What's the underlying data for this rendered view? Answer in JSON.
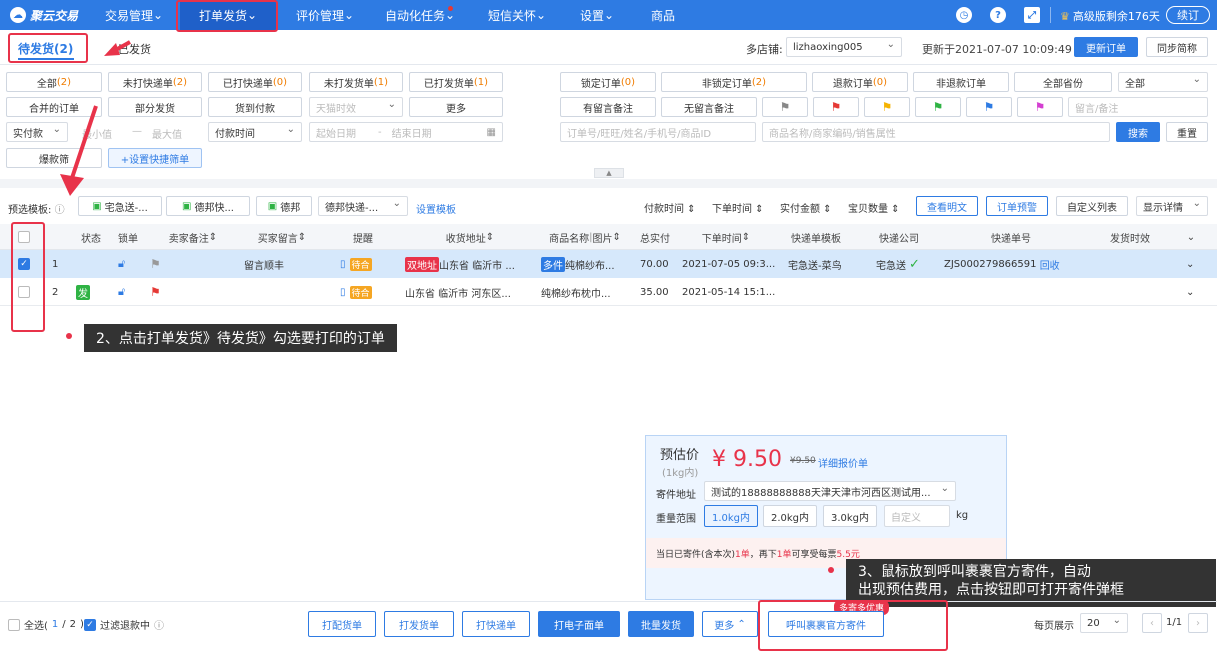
{
  "topbar": {
    "logo": "聚云交易",
    "nav": [
      "交易管理",
      "打单发货",
      "评价管理",
      "自动化任务",
      "短信关怀",
      "设置",
      "商品"
    ],
    "version": "高级版剩余176天",
    "renew": "续订"
  },
  "tabs": {
    "pending": "待发货(2)",
    "shipped": "已发货"
  },
  "header": {
    "store_label": "多店铺:",
    "store_value": "lizhaoxing005",
    "updated": "更新于2021-07-07 10:09:49",
    "update_btn": "更新订单",
    "sync_btn": "同步简称"
  },
  "filters": {
    "r1": [
      "全部",
      "(2)",
      "未打快递单",
      "(2)",
      "已打快递单",
      "(0)",
      "未打发货单",
      "(1)",
      "已打发货单",
      "(1)"
    ],
    "r1b": [
      "锁定订单",
      "(0)",
      "非锁定订单",
      "(2)",
      "退款订单",
      "(0)",
      "非退款订单",
      "全部省份",
      "全部"
    ],
    "r2": [
      "合并的订单",
      "部分发货",
      "货到付款",
      "天猫时效",
      "更多"
    ],
    "r2b": [
      "有留言备注",
      "无留言备注",
      "留言/备注"
    ],
    "r3": [
      "实付款",
      "最小值",
      "—",
      "最大值",
      "付款时间",
      "起始日期",
      "-",
      "结束日期"
    ],
    "r3b": [
      "订单号/旺旺/姓名/手机号/商品ID",
      "商品名称/商家编码/销售属性",
      "搜索",
      "重置"
    ],
    "r4": [
      "爆款筛",
      "+设置快捷筛单"
    ]
  },
  "templates": {
    "label": "预选模板:",
    "items": [
      "宅急送-...",
      "德邦快...",
      "德邦",
      "德邦快递-..."
    ],
    "set": "设置模板"
  },
  "sorts": [
    "付款时间",
    "下单时间",
    "实付金额",
    "宝贝数量"
  ],
  "viewbtns": [
    "查看明文",
    "订单预警",
    "自定义列表",
    "显示详情"
  ],
  "columns": [
    "状态",
    "锁单",
    "卖家备注",
    "买家留言",
    "提醒",
    "收货地址",
    "商品名称",
    "图片",
    "总实付",
    "下单时间",
    "快递单模板",
    "快递公司",
    "快递单号",
    "发货时效"
  ],
  "rows": [
    {
      "no": "1",
      "msg": "留言顺丰",
      "remind": "待合",
      "tag": "双地址",
      "addr": "山东省 临沂市 ...",
      "goods_tag": "多件",
      "goods": "纯棉纱布...",
      "total": "70.00",
      "time": "2021-07-05 09:3...",
      "tpl": "宅急送-菜鸟",
      "express": "宅急送",
      "check": "✓",
      "tracking": "ZJS000279866591",
      "recall": "回收"
    },
    {
      "no": "2",
      "status": "发",
      "remind": "待合",
      "addr": "山东省 临沂市 河东区...",
      "goods": "纯棉纱布枕巾...",
      "total": "35.00",
      "time": "2021-05-14 15:1..."
    }
  ],
  "callouts": {
    "c2": "2、点击打单发货》待发货》勾选要打印的订单",
    "c3a": "3、鼠标放到呼叫裹裹官方寄件，自动",
    "c3b": "出现预估费用，点击按钮即可打开寄件弹框"
  },
  "estimate": {
    "title": "预估价",
    "unit": "(1kg内)",
    "price": "¥ 9.50",
    "old": "¥9.50",
    "detail": "详细报价单",
    "addr_label": "寄件地址",
    "addr": "测试的18888888888天津天津市河西区测试用...",
    "w_label": "重量范围",
    "w": [
      "1.0kg内",
      "2.0kg内",
      "3.0kg内"
    ],
    "custom": "自定义",
    "kg": "kg",
    "note_a": "当日已寄件(含本次)",
    "n1": "1单",
    "note_b": "，再下",
    "n2": "1单",
    "note_c": "可享受每票",
    "save": "5.5元",
    "promo": "多寄多优惠"
  },
  "footer": {
    "all": "全选(",
    "sel": "1",
    "slash": "/",
    "total": "2",
    ")": ")",
    "filter": "过滤退款中",
    "btns": [
      "打配货单",
      "打发货单",
      "打快递单",
      "打电子面单",
      "批量发货",
      "更多",
      "呼叫裹裹官方寄件"
    ],
    "per_label": "每页展示",
    "per": "20",
    "page": "1/1"
  },
  "colors": {
    "primary": "#2e7be3",
    "annot": "#e8334a",
    "price": "#e8334a"
  }
}
